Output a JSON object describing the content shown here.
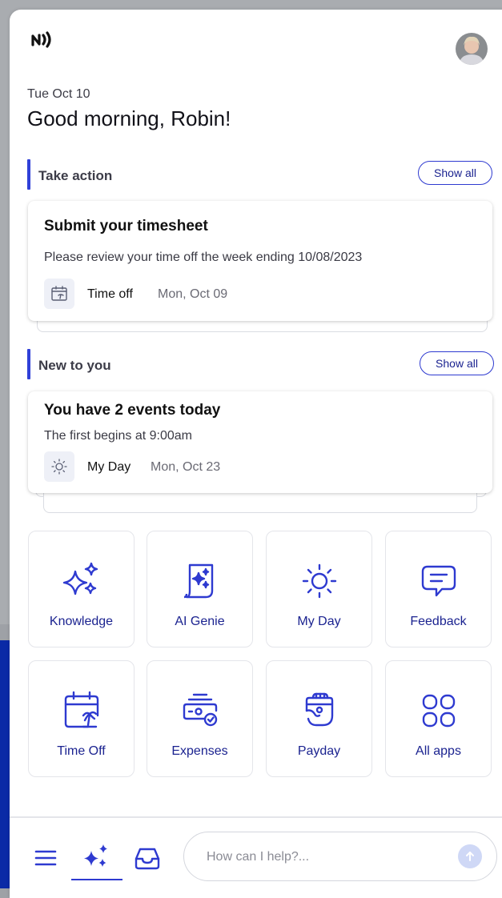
{
  "header": {
    "date": "Tue Oct 10",
    "greeting": "Good morning, Robin!"
  },
  "take_action": {
    "title": "Take action",
    "show_all_label": "Show all",
    "card": {
      "title": "Submit your timesheet",
      "description": "Please review your time off the week ending 10/08/2023",
      "chip_label": "Time off",
      "chip_date": "Mon, Oct 09",
      "chip_icon": "calendar-palm-icon"
    }
  },
  "new_to_you": {
    "title": "New to you",
    "show_all_label": "Show all",
    "card": {
      "title": "You have 2 events today",
      "description": "The first begins at 9:00am",
      "chip_label": "My Day",
      "chip_date": "Mon, Oct 23",
      "chip_icon": "sun-icon"
    }
  },
  "apps": [
    {
      "label": "Knowledge",
      "icon": "sparkles-icon"
    },
    {
      "label": "AI Genie",
      "icon": "ai-document-icon"
    },
    {
      "label": "My Day",
      "icon": "sun-icon"
    },
    {
      "label": "Feedback",
      "icon": "chat-bubble-icon"
    },
    {
      "label": "Time Off",
      "icon": "calendar-palm-icon"
    },
    {
      "label": "Expenses",
      "icon": "expenses-icon"
    },
    {
      "label": "Payday",
      "icon": "payday-icon"
    },
    {
      "label": "All apps",
      "icon": "grid-icon"
    }
  ],
  "bottom_bar": {
    "search_placeholder": "How can I help?..."
  },
  "colors": {
    "accent": "#2e3ad0",
    "accent_dark": "#1b2390",
    "section_bar": "#3040d8"
  }
}
